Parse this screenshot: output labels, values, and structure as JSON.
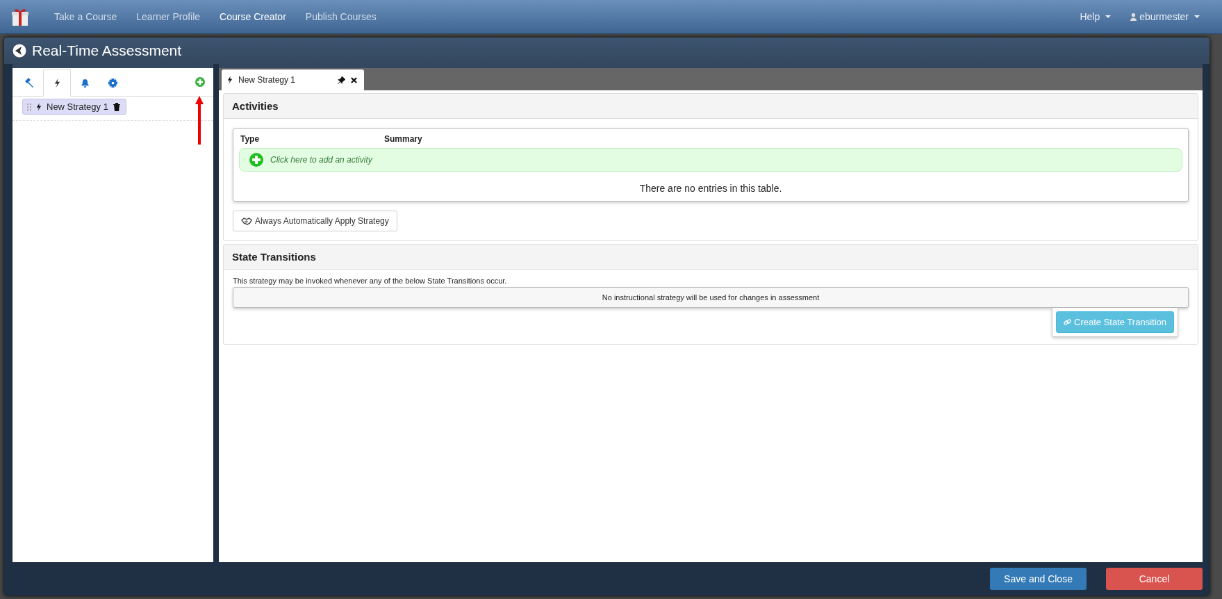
{
  "navbar": {
    "items": [
      {
        "label": "Take a Course",
        "selected": false
      },
      {
        "label": "Learner Profile",
        "selected": false
      },
      {
        "label": "Course Creator",
        "selected": true
      },
      {
        "label": "Publish Courses",
        "selected": false
      }
    ],
    "help": "Help",
    "user": "eburmester"
  },
  "modal": {
    "title": "Real-Time Assessment"
  },
  "sidebar": {
    "tabs": [
      {
        "kind": "hammer",
        "selected": false
      },
      {
        "kind": "bolt",
        "selected": true
      },
      {
        "kind": "bell",
        "selected": false
      },
      {
        "kind": "gear",
        "selected": false
      }
    ],
    "items": [
      {
        "name": "New Strategy 1"
      }
    ]
  },
  "doc_tab": {
    "label": "New Strategy 1"
  },
  "activities": {
    "title": "Activities",
    "columns": [
      "Type",
      "Summary"
    ],
    "add_row": "Click here to add an activity",
    "empty": "There are no entries in this table.",
    "button": "Always Automatically Apply Strategy"
  },
  "state_transitions": {
    "title": "State Transitions",
    "description": "This strategy may be invoked whenever any of the below State Transitions occur.",
    "empty": "No instructional strategy will be used for changes in assessment",
    "button": "Create State Transition"
  },
  "footer": {
    "save": "Save and Close",
    "cancel": "Cancel"
  }
}
